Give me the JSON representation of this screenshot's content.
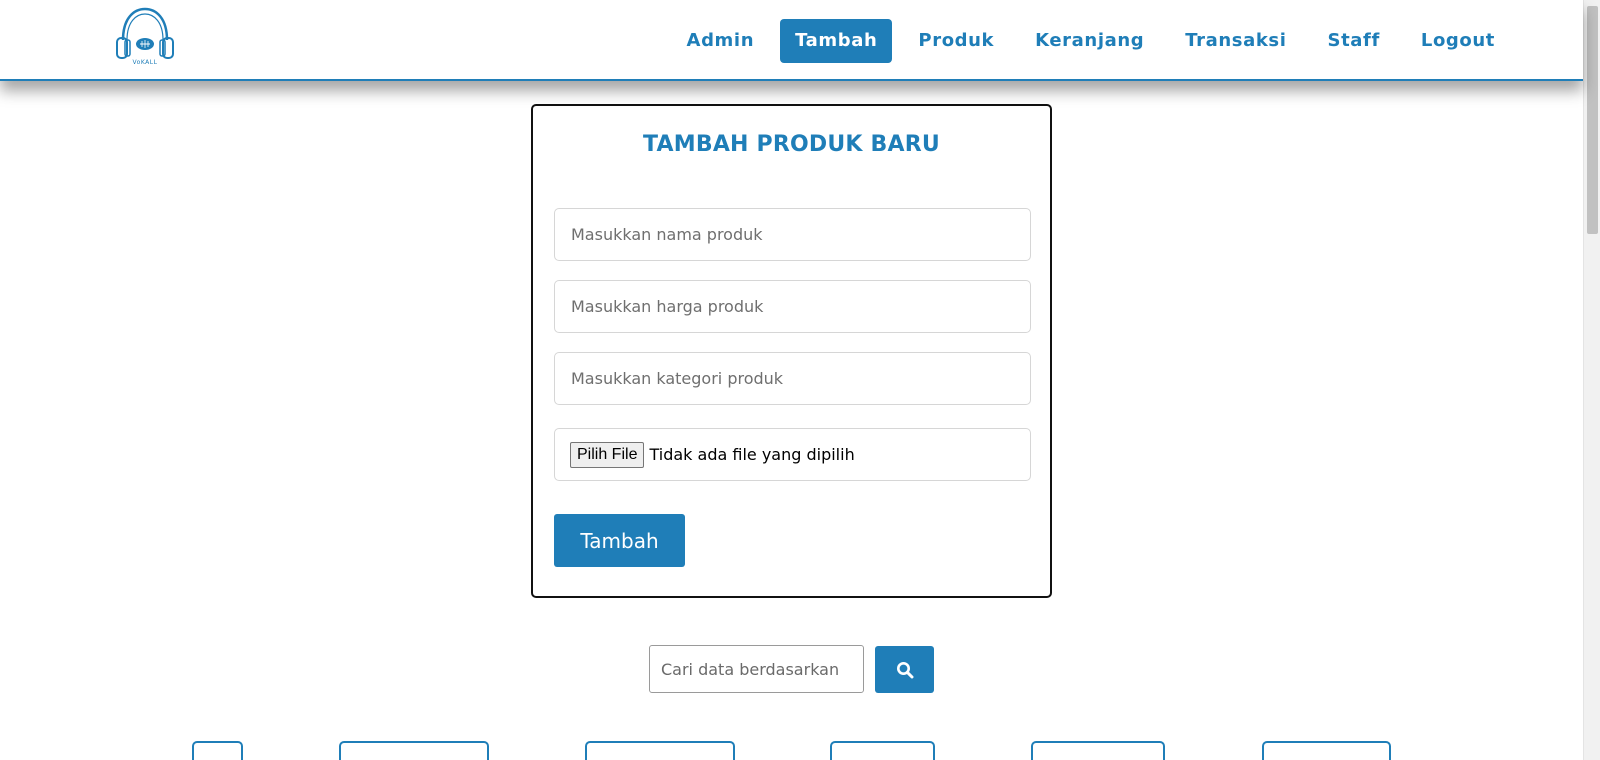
{
  "header": {
    "logo_text": "VoKALL",
    "nav": [
      {
        "label": "Admin",
        "active": false
      },
      {
        "label": "Tambah",
        "active": true
      },
      {
        "label": "Produk",
        "active": false
      },
      {
        "label": "Keranjang",
        "active": false
      },
      {
        "label": "Transaksi",
        "active": false
      },
      {
        "label": "Staff",
        "active": false
      },
      {
        "label": "Logout",
        "active": false
      }
    ]
  },
  "form": {
    "title": "TAMBAH PRODUK BARU",
    "name_placeholder": "Masukkan nama produk",
    "price_placeholder": "Masukkan harga produk",
    "category_placeholder": "Masukkan kategori produk",
    "file_button_label": "Pilih File",
    "file_status": "Tidak ada file yang dipilih",
    "submit_label": "Tambah"
  },
  "search": {
    "placeholder": "Cari data berdasarkan"
  },
  "colors": {
    "accent": "#1f7eb8",
    "card_border": "#111111"
  },
  "icons": {
    "logo": "headphones-icon",
    "search": "search-icon"
  }
}
